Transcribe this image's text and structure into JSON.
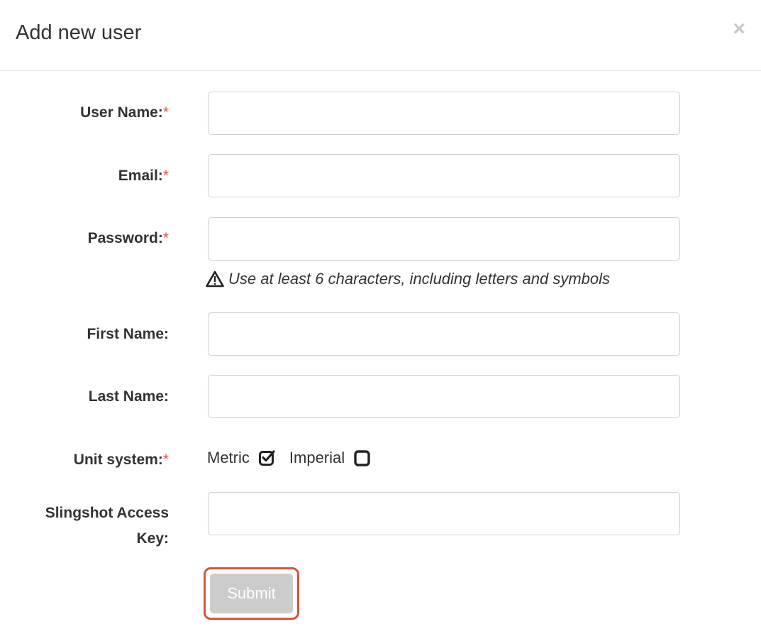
{
  "modal": {
    "title": "Add new user",
    "close_symbol": "×"
  },
  "fields": {
    "username": {
      "label": "User Name:",
      "required_mark": "*",
      "value": ""
    },
    "email": {
      "label": "Email:",
      "required_mark": "*",
      "value": ""
    },
    "password": {
      "label": "Password:",
      "required_mark": "*",
      "value": ""
    },
    "password_hint": "Use at least 6 characters, including letters and symbols",
    "first_name": {
      "label": "First Name:",
      "value": ""
    },
    "last_name": {
      "label": "Last Name:",
      "value": ""
    },
    "unit_system": {
      "label": "Unit system:",
      "required_mark": "*",
      "options": [
        {
          "label": "Metric",
          "checked": true
        },
        {
          "label": "Imperial",
          "checked": false
        }
      ]
    },
    "slingshot_key": {
      "label_line1": "Slingshot Access",
      "label_line2": "Key:",
      "value": ""
    }
  },
  "submit": {
    "label": "Submit"
  },
  "colors": {
    "required": "#d9534f",
    "highlight_border": "#d9533e",
    "button_disabled": "#cccccc"
  },
  "icons": {
    "close": "close-icon",
    "warning": "warning-triangle-icon",
    "checked": "checkbox-checked-icon",
    "unchecked": "checkbox-unchecked-icon"
  }
}
